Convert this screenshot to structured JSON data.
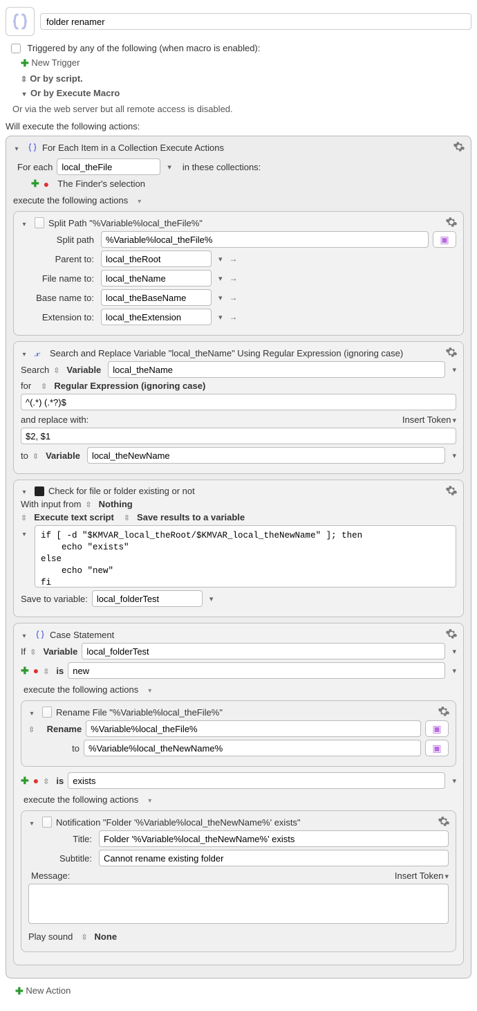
{
  "header": {
    "macro_name": "folder renamer"
  },
  "triggers": {
    "triggered_by_label": "Triggered by any of the following (when macro is enabled):",
    "new_trigger": "New Trigger",
    "or_by_script": "Or by script.",
    "or_by_execute": "Or by Execute Macro",
    "web_server_label": "Or via the web server but all remote access is disabled."
  },
  "will_execute_label": "Will execute the following actions:",
  "foreach": {
    "title": "For Each Item in a Collection Execute Actions",
    "for_each_label": "For each",
    "variable": "local_theFile",
    "in_label": "in these collections:",
    "collection_label": "The Finder's selection",
    "exec_line": "execute the following actions"
  },
  "split": {
    "title": "Split Path \"%Variable%local_theFile%\"",
    "split_path_label": "Split path",
    "split_path_value": "%Variable%local_theFile%",
    "parent_label": "Parent to:",
    "parent_value": "local_theRoot",
    "file_label": "File name to:",
    "file_value": "local_theName",
    "base_label": "Base name to:",
    "base_value": "local_theBaseName",
    "ext_label": "Extension to:",
    "ext_value": "local_theExtension"
  },
  "search": {
    "title": "Search and Replace Variable \"local_theName\" Using Regular Expression (ignoring case)",
    "search_label": "Search",
    "variable_kind": "Variable",
    "search_var": "local_theName",
    "for_label": "for",
    "mode": "Regular Expression (ignoring case)",
    "pattern": "^(.*) (.*?)$",
    "replace_label": "and replace with:",
    "insert_token": "Insert Token",
    "replace_value": "$2, $1",
    "to_label": "to",
    "to_var": "local_theNewName"
  },
  "shell": {
    "title": "Check for file or folder existing or not",
    "input_label": "With input from",
    "input_mode": "Nothing",
    "exec_label": "Execute text script",
    "save_label": "Save results to a variable",
    "script": "if [ -d \"$KMVAR_local_theRoot/$KMVAR_local_theNewName\" ]; then\n    echo \"exists\"\nelse\n    echo \"new\"\nfi",
    "save_to_label": "Save to variable:",
    "save_to_var": "local_folderTest"
  },
  "caseblk": {
    "title": "Case Statement",
    "if_label": "If",
    "variable_kind": "Variable",
    "if_var": "local_folderTest",
    "is_label": "is",
    "case1_value": "new",
    "case2_value": "exists",
    "exec_line": "execute the following actions"
  },
  "rename": {
    "title": "Rename File \"%Variable%local_theFile%\"",
    "rename_label": "Rename",
    "from_value": "%Variable%local_theFile%",
    "to_label": "to",
    "to_value": "%Variable%local_theNewName%"
  },
  "notify": {
    "title": "Notification \"Folder '%Variable%local_theNewName%' exists\"",
    "title_label": "Title:",
    "title_value": "Folder '%Variable%local_theNewName%' exists",
    "subtitle_label": "Subtitle:",
    "subtitle_value": "Cannot rename existing folder",
    "message_label": "Message:",
    "insert_token": "Insert Token",
    "message_value": "",
    "play_sound_label": "Play sound",
    "play_sound_value": "None"
  },
  "new_action": "New Action"
}
